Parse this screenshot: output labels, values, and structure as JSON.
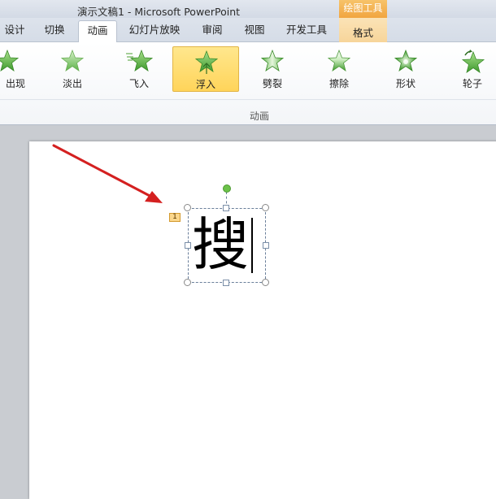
{
  "window": {
    "title": "演示文稿1 - Microsoft PowerPoint",
    "context_header": "绘图工具"
  },
  "tabs": [
    {
      "label": "设计"
    },
    {
      "label": "切换"
    },
    {
      "label": "动画",
      "active": true
    },
    {
      "label": "幻灯片放映"
    },
    {
      "label": "审阅"
    },
    {
      "label": "视图"
    },
    {
      "label": "开发工具"
    },
    {
      "label": "格式",
      "contextual": true
    }
  ],
  "ribbon": {
    "group_label": "动画",
    "animations": [
      {
        "label": "出现",
        "icon": "star-appear-icon"
      },
      {
        "label": "淡出",
        "icon": "star-fade-icon"
      },
      {
        "label": "飞入",
        "icon": "star-fly-in-icon"
      },
      {
        "label": "浮入",
        "icon": "star-float-in-icon",
        "selected": true
      },
      {
        "label": "劈裂",
        "icon": "star-split-icon"
      },
      {
        "label": "擦除",
        "icon": "star-wipe-icon"
      },
      {
        "label": "形状",
        "icon": "star-shape-icon"
      },
      {
        "label": "轮子",
        "icon": "star-wheel-icon"
      }
    ]
  },
  "slide": {
    "text": "搜",
    "animation_badge": "1"
  },
  "colors": {
    "accent": "#f1a53f",
    "selected_item": "#ffd45a",
    "star_green": "#5fb34a",
    "arrow_red": "#d42020"
  }
}
